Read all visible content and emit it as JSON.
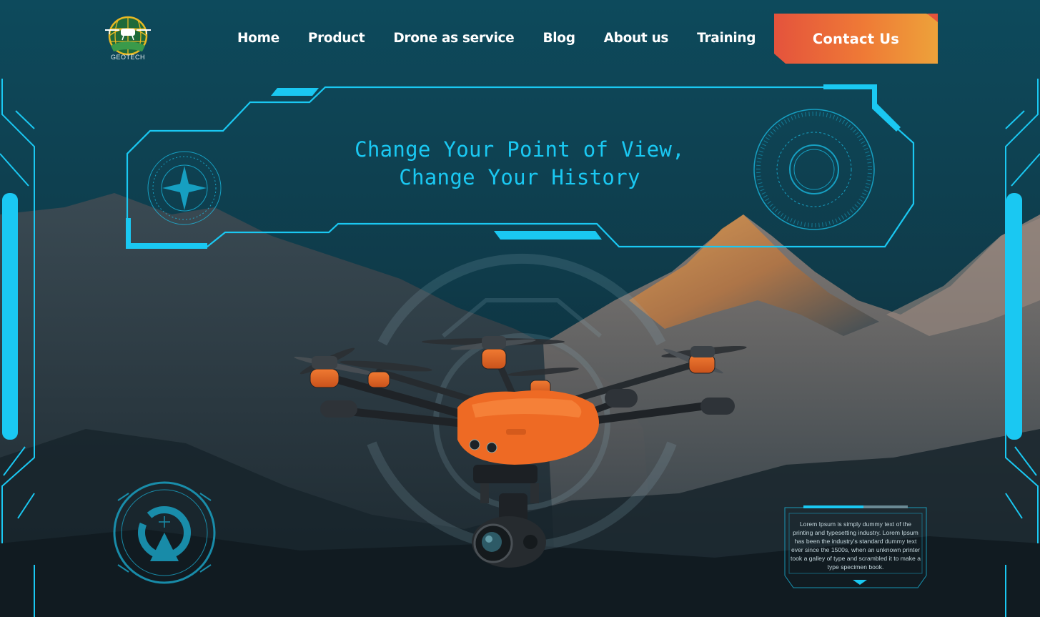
{
  "brand": {
    "name": "GEOTECH"
  },
  "nav": {
    "items": [
      {
        "label": "Home"
      },
      {
        "label": "Product"
      },
      {
        "label": "Drone as service"
      },
      {
        "label": "Blog"
      },
      {
        "label": "About us"
      },
      {
        "label": "Training"
      }
    ],
    "contact_label": "Contact Us"
  },
  "hero": {
    "headline_line1": "Change Your Point of View,",
    "headline_line2": "Change Your History"
  },
  "info_box": {
    "text": "Lorem Ipsum is simply dummy text of the printing and typesetting industry. Lorem Ipsum has been the industry's standard dummy text ever since the 1500s, when an unknown printer took a galley of type and scrambled it to make a type specimen book."
  },
  "colors": {
    "background": "#0c2e3a",
    "accent_cyan": "#1ac8f2",
    "cta_start": "#e4533c",
    "cta_end": "#eda23a",
    "drone_orange": "#ee6a24"
  },
  "icons": [
    "logo-globe-drone-icon",
    "compass-icon",
    "radar-ring-icon",
    "target-scope-icon",
    "drone-image"
  ]
}
